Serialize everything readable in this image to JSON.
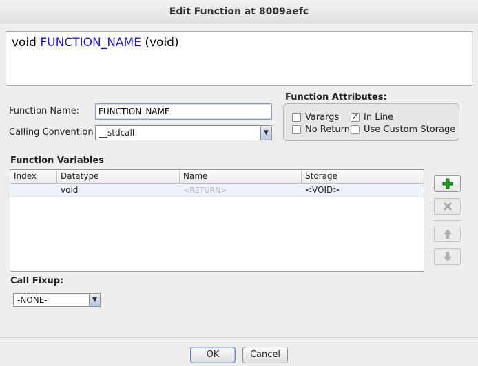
{
  "window": {
    "title": "Edit Function at 8009aefc"
  },
  "signature": {
    "return_type": "void",
    "name": "FUNCTION_NAME",
    "params": "(void)"
  },
  "form": {
    "function_name_label": "Function Name:",
    "function_name_value": "FUNCTION_NAME",
    "calling_convention_label": "Calling Convention",
    "calling_convention_value": "__stdcall",
    "call_fixup_label": "Call Fixup:",
    "call_fixup_value": "-NONE-"
  },
  "attributes": {
    "title": "Function Attributes:",
    "varargs": {
      "label": "Varargs",
      "checked": false
    },
    "inline": {
      "label": "In Line",
      "checked": true
    },
    "no_return": {
      "label": "No Return",
      "checked": false
    },
    "custom_storage": {
      "label": "Use Custom Storage",
      "checked": false
    }
  },
  "variables": {
    "title": "Function Variables",
    "columns": [
      "Index",
      "Datatype",
      "Name",
      "Storage"
    ],
    "rows": [
      {
        "index": "",
        "datatype": "void",
        "name": "<RETURN>",
        "storage": "<VOID>"
      }
    ]
  },
  "side_buttons": {
    "add": "plus-icon",
    "remove": "x-icon",
    "up": "arrow-up-icon",
    "down": "arrow-down-icon"
  },
  "buttons": {
    "ok": "OK",
    "cancel": "Cancel"
  },
  "colors": {
    "name_blue": "#1a1acc",
    "add_green": "#22a022"
  }
}
